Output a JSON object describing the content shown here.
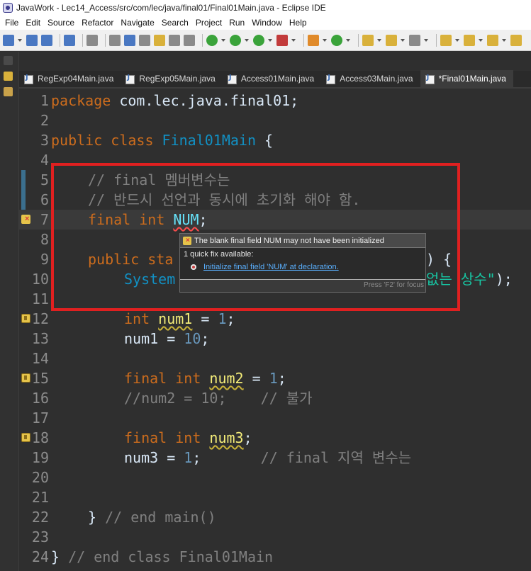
{
  "window": {
    "title": "JavaWork - Lec14_Access/src/com/lec/java/final01/Final01Main.java - Eclipse IDE"
  },
  "menu": [
    "File",
    "Edit",
    "Source",
    "Refactor",
    "Navigate",
    "Search",
    "Project",
    "Run",
    "Window",
    "Help"
  ],
  "tabs": [
    {
      "label": "RegExp04Main.java",
      "active": false
    },
    {
      "label": "RegExp05Main.java",
      "active": false
    },
    {
      "label": "Access01Main.java",
      "active": false
    },
    {
      "label": "Access03Main.java",
      "active": false
    },
    {
      "label": "*Final01Main.java",
      "active": true
    }
  ],
  "editor": {
    "line_numbers": [
      "1",
      "2",
      "3",
      "4",
      "5",
      "6",
      "7",
      "8",
      "9",
      "10",
      "11",
      "12",
      "13",
      "14",
      "15",
      "16",
      "17",
      "18",
      "19",
      "20",
      "21",
      "22",
      "23",
      "24"
    ],
    "lines": {
      "l1_kw": "package",
      "l1_rest": " com.lec.java.final01;",
      "l3_kw1": "public",
      "l3_kw2": " class ",
      "l3_cls": "Final01Main",
      "l3_rest": " {",
      "l5_cm": "// final 멤버변수는",
      "l6_cm": "// 반드시 선언과 동시에 초기화 해야 함.",
      "l7_kw": "final int ",
      "l7_fld": "NUM",
      "l7_rest": ";",
      "l9_kw": "public sta",
      "l9_rest": ") {",
      "l10_ident": "System",
      "l10_str": "없는 상수\"",
      "l10_rest": ");",
      "l12_kw": "int ",
      "l12_var": "num1",
      "l12_op": " = ",
      "l12_num": "1",
      "l12_end": ";",
      "l13_ident": "num1 = ",
      "l13_num": "10",
      "l13_end": ";",
      "l15_kw": "final int ",
      "l15_var": "num2",
      "l15_op": " = ",
      "l15_num": "1",
      "l15_end": ";",
      "l16_cm": "//num2 = 10;    // 불가",
      "l18_kw": "final int ",
      "l18_var": "num3",
      "l18_end": ";",
      "l19_ident": "num3 = ",
      "l19_num": "1",
      "l19_end": ";",
      "l19_cm": "       // final 지역 변수는",
      "l22_brace": "} ",
      "l22_cm": "// end main()",
      "l24_brace": "} ",
      "l24_cm": "// end class Final01Main"
    }
  },
  "hover": {
    "error_message": "The blank final field NUM may not have been initialized",
    "quick_fix_title": "1 quick fix available:",
    "quick_fix_link": "Initialize final field 'NUM' at declaration.",
    "focus_hint": "Press 'F2' for focus"
  }
}
